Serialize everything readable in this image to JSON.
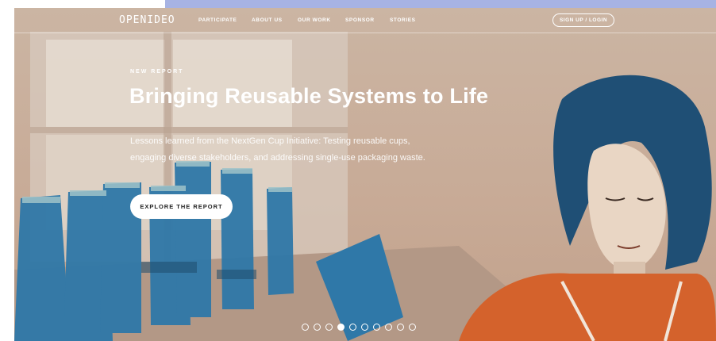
{
  "nav": {
    "logo": "OPENIDEO",
    "links": [
      "PARTICIPATE",
      "ABOUT US",
      "OUR WORK",
      "SPONSOR",
      "STORIES"
    ],
    "signup_label": "SIGN UP / LOGIN"
  },
  "hero": {
    "eyebrow": "NEW REPORT",
    "title": "Bringing Reusable Systems to Life",
    "description": "Lessons learned from the NextGen Cup Initiative: Testing reusable cups, engaging diverse stakeholders, and addressing single-use packaging waste.",
    "cta_label": "EXPLORE THE REPORT"
  },
  "carousel": {
    "total": 10,
    "active_index": 3
  },
  "colors": {
    "accent_bar": "#a7b3e3",
    "cup_blue": "#2f78a8",
    "shirt_orange": "#d4622c",
    "hair_navy": "#1f4f75"
  }
}
